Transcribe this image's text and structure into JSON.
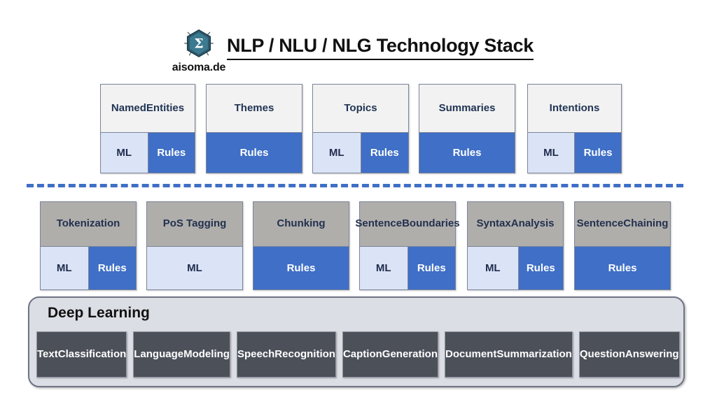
{
  "header": {
    "logo_text": "aisoma.de",
    "logo_icon": "hexagon-sigma-logo-icon",
    "title": "NLP / NLU / NLG Technology Stack"
  },
  "colors": {
    "rules_blue": "#3f6fc6",
    "ml_light_blue": "#dbe4f6",
    "row1_head": "#f2f2f2",
    "row2_head": "#b0aeab",
    "divider_blue": "#3f6fc6",
    "dl_panel": "#dcdee5",
    "dl_item": "#4c5059",
    "title_black": "#111111"
  },
  "labels": {
    "ml": "ML",
    "rules": "Rules"
  },
  "row1": {
    "cards": [
      {
        "title": "Named\nEntities",
        "title_lines": [
          "Named",
          "Entities"
        ],
        "segments": [
          {
            "label": "ML",
            "type": "ml",
            "weight": 50
          },
          {
            "label": "Rules",
            "type": "rules",
            "weight": 50
          }
        ]
      },
      {
        "title": "Themes",
        "title_lines": [
          "Themes"
        ],
        "segments": [
          {
            "label": "Rules",
            "type": "rules",
            "weight": 100
          }
        ]
      },
      {
        "title": "Topics",
        "title_lines": [
          "Topics"
        ],
        "segments": [
          {
            "label": "ML",
            "type": "ml",
            "weight": 50
          },
          {
            "label": "Rules",
            "type": "rules",
            "weight": 50
          }
        ]
      },
      {
        "title": "Summaries",
        "title_lines": [
          "Summaries"
        ],
        "segments": [
          {
            "label": "Rules",
            "type": "rules",
            "weight": 100
          }
        ]
      },
      {
        "title": "Intentions",
        "title_lines": [
          "Intentions"
        ],
        "segments": [
          {
            "label": "ML",
            "type": "ml",
            "weight": 50
          },
          {
            "label": "Rules",
            "type": "rules",
            "weight": 50
          }
        ]
      }
    ]
  },
  "row2": {
    "cards": [
      {
        "title": "Tokenization",
        "title_lines": [
          "Tokenization"
        ],
        "segments": [
          {
            "label": "ML",
            "type": "ml",
            "weight": 50
          },
          {
            "label": "Rules",
            "type": "rules",
            "weight": 50
          }
        ]
      },
      {
        "title": "PoS Tagging",
        "title_lines": [
          "PoS Tagging"
        ],
        "segments": [
          {
            "label": "ML",
            "type": "ml",
            "weight": 100
          }
        ]
      },
      {
        "title": "Chunking",
        "title_lines": [
          "Chunking"
        ],
        "segments": [
          {
            "label": "Rules",
            "type": "rules",
            "weight": 100
          }
        ]
      },
      {
        "title": "Sentence Boundaries",
        "title_lines": [
          "Sentence",
          "Boundaries"
        ],
        "segments": [
          {
            "label": "ML",
            "type": "ml",
            "weight": 50
          },
          {
            "label": "Rules",
            "type": "rules",
            "weight": 50
          }
        ]
      },
      {
        "title": "Syntax Analysis",
        "title_lines": [
          "Syntax",
          "Analysis"
        ],
        "segments": [
          {
            "label": "ML",
            "type": "ml",
            "weight": 53
          },
          {
            "label": "Rules",
            "type": "rules",
            "weight": 47
          }
        ]
      },
      {
        "title": "Sentence Chaining",
        "title_lines": [
          "Sentence",
          "Chaining"
        ],
        "segments": [
          {
            "label": "Rules",
            "type": "rules",
            "weight": 100
          }
        ]
      }
    ]
  },
  "deep_learning": {
    "title": "Deep Learning",
    "items": [
      {
        "lines": [
          "Text",
          "Classification"
        ],
        "text": "Text Classification"
      },
      {
        "lines": [
          "Language",
          "Modeling"
        ],
        "text": "Language Modeling"
      },
      {
        "lines": [
          "Speech",
          "Recognition"
        ],
        "text": "Speech Recognition"
      },
      {
        "lines": [
          "Caption",
          "Generation"
        ],
        "text": "Caption Generation"
      },
      {
        "lines": [
          "Document",
          "Summarization"
        ],
        "text": "Document Summarization"
      },
      {
        "lines": [
          "Question",
          "Answering"
        ],
        "text": "Question Answering"
      }
    ]
  }
}
